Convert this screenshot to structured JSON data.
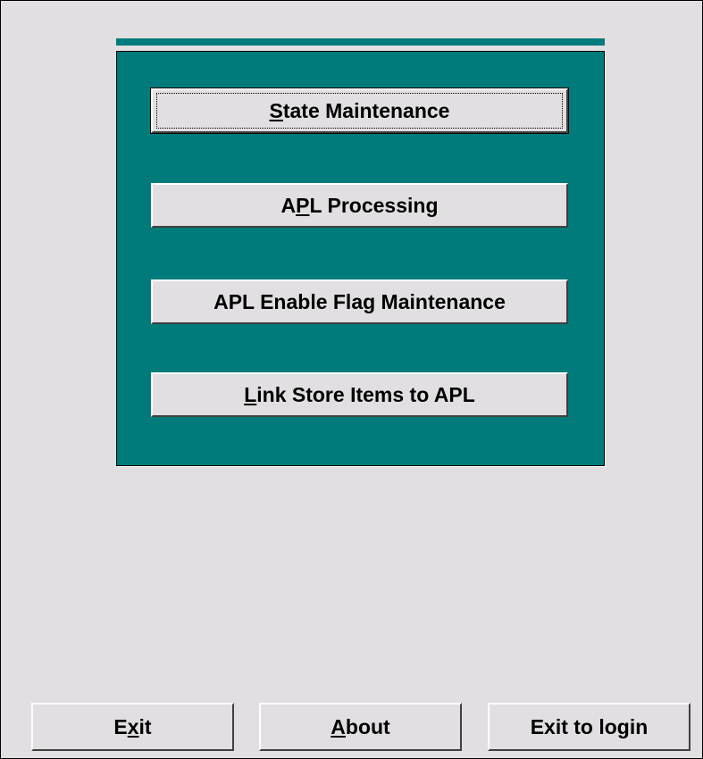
{
  "menu_panel": {
    "buttons": [
      {
        "pre": "",
        "key": "S",
        "post": "tate Maintenance",
        "focused": true
      },
      {
        "pre": "A",
        "key": "P",
        "post": "L Processing",
        "focused": false
      },
      {
        "pre": "APL Enable Flag Maintenance",
        "key": "",
        "post": "",
        "focused": false
      },
      {
        "pre": "",
        "key": "L",
        "post": "ink Store Items to APL",
        "focused": false
      }
    ]
  },
  "footer": {
    "exit": {
      "pre": "E",
      "key": "x",
      "post": "it"
    },
    "about": {
      "pre": "",
      "key": "A",
      "post": "bout"
    },
    "exit_to_login": {
      "pre": "Exit to login",
      "key": "",
      "post": ""
    }
  },
  "colors": {
    "panel": "#007b7b",
    "window": "#e1dfe1"
  }
}
